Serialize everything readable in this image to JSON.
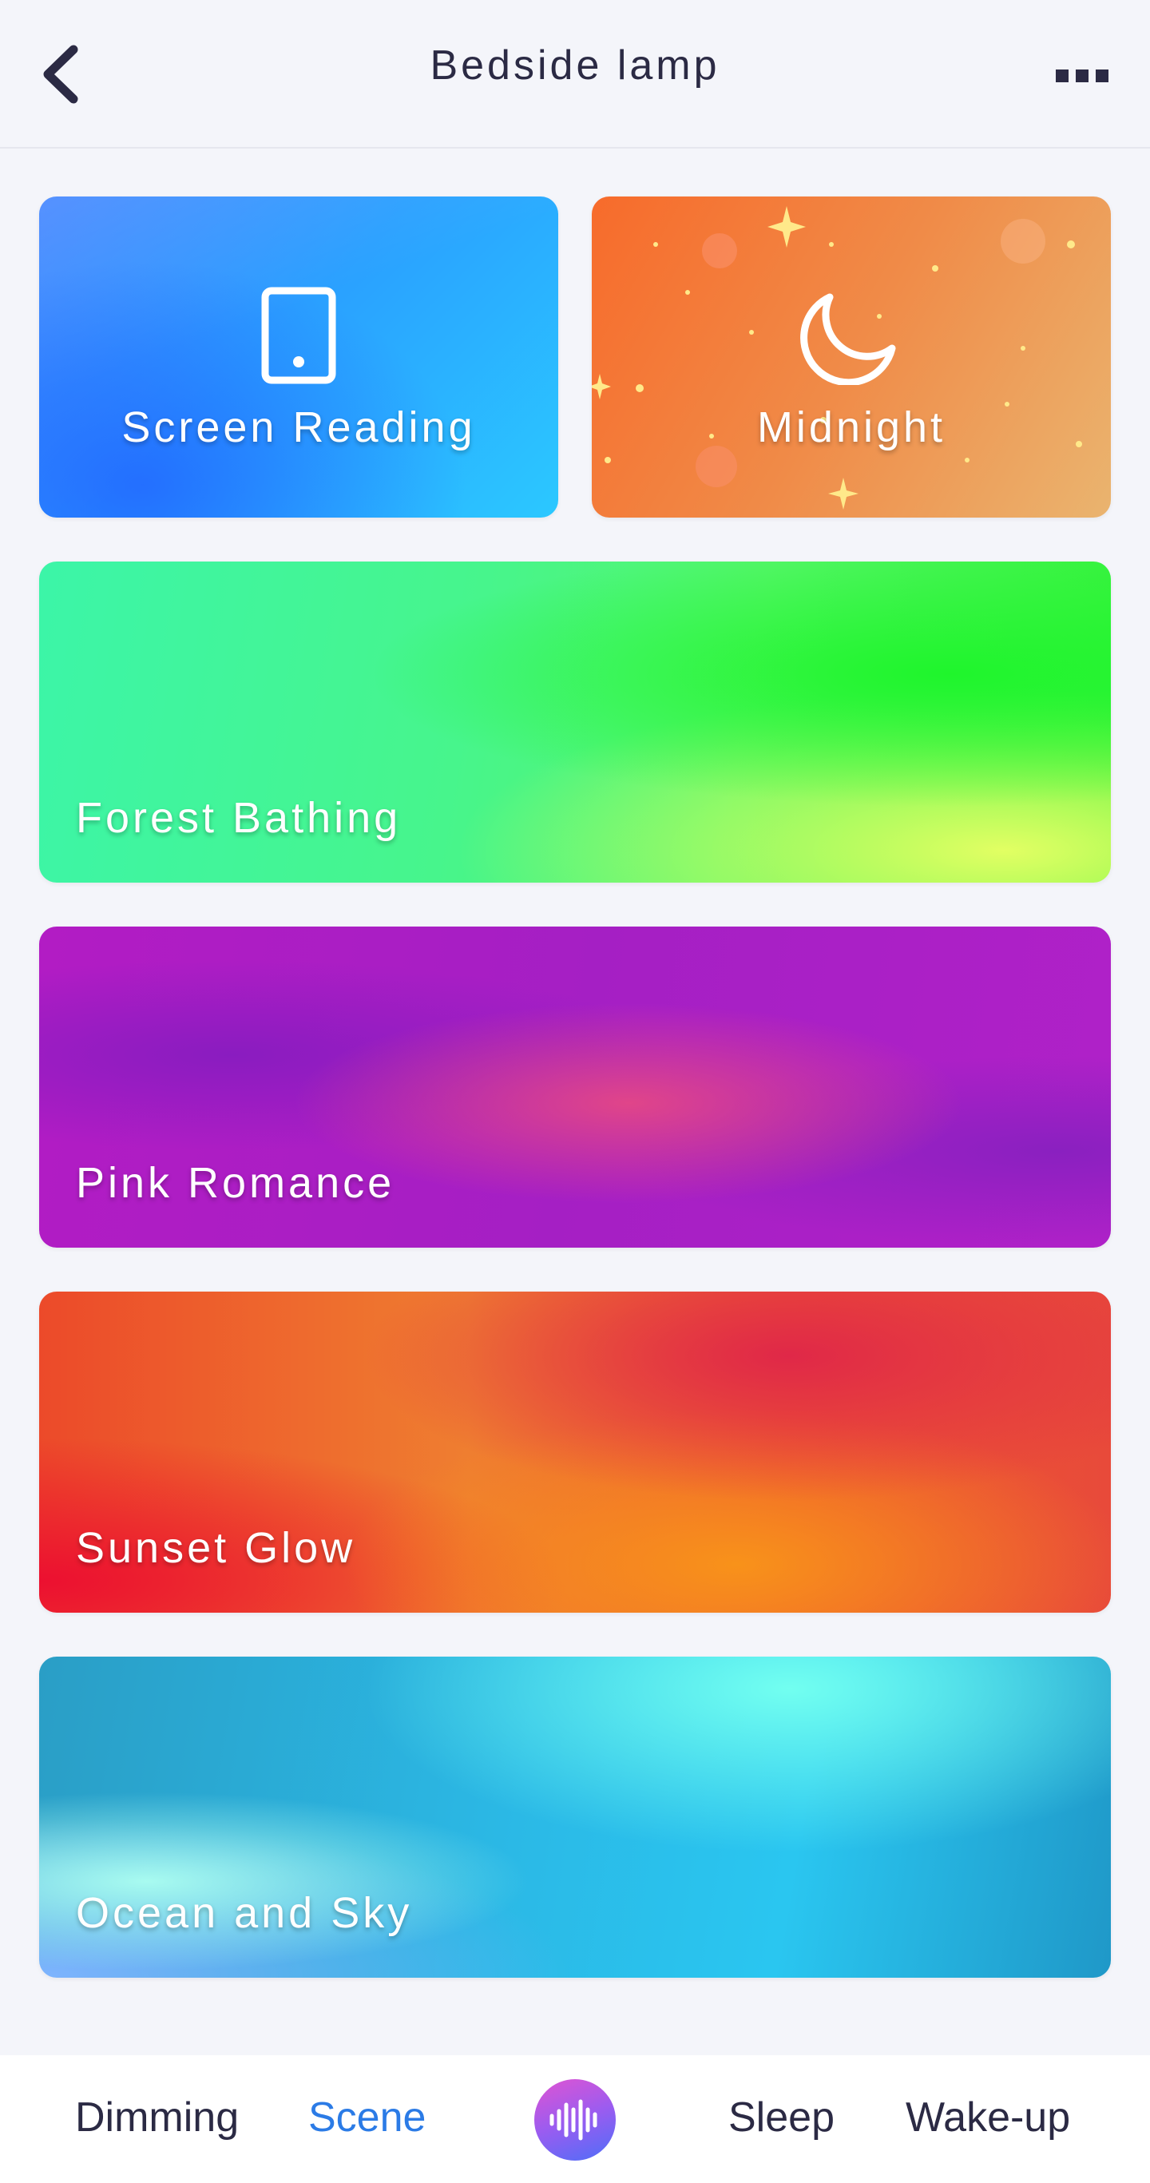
{
  "header": {
    "title": "Bedside lamp",
    "back_icon": "chevron-left-icon",
    "more_icon": "more-horizontal-icon"
  },
  "scenes": [
    {
      "label": "Screen Reading",
      "icon": "tablet-icon"
    },
    {
      "label": "Midnight",
      "icon": "moon-icon"
    },
    {
      "label": "Forest Bathing"
    },
    {
      "label": "Pink Romance"
    },
    {
      "label": "Sunset Glow"
    },
    {
      "label": "Ocean and Sky"
    }
  ],
  "bottom_nav": {
    "items": [
      {
        "label": "Dimming"
      },
      {
        "label": "Scene",
        "active": true
      },
      {
        "label": "Sleep"
      },
      {
        "label": "Wake-up"
      }
    ],
    "center_icon": "sound-wave-icon",
    "active_color": "#2b7be6"
  },
  "colors": {
    "background": "#f4f5fa",
    "text": "#2b2a44"
  }
}
